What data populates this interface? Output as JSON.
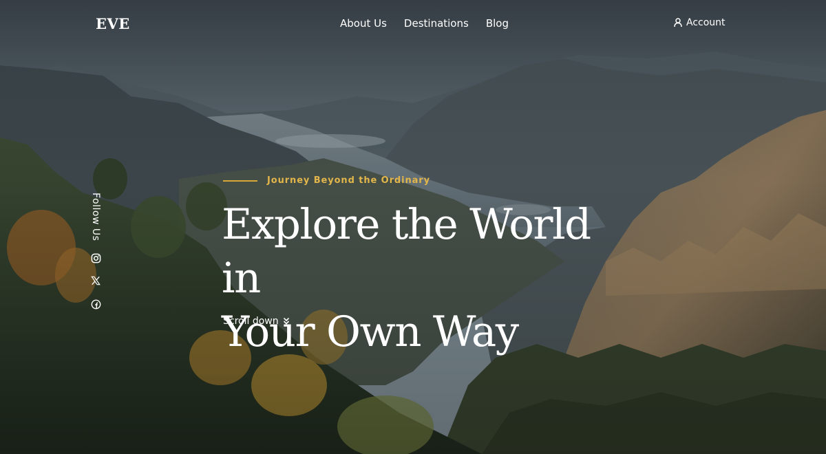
{
  "header": {
    "logo": "EVE",
    "nav": [
      "About Us",
      "Destinations",
      "Blog"
    ],
    "account_label": "Account",
    "account_icon": "user-icon"
  },
  "social": {
    "label": "Follow Us",
    "icons": [
      "instagram-icon",
      "x-icon",
      "facebook-icon"
    ]
  },
  "hero": {
    "tagline": "Journey Beyond the Ordinary",
    "headline_line1": "Explore the World in",
    "headline_line2": "Your Own Way",
    "scroll_label": "Scroll down",
    "scroll_icon": "chevrons-down-icon"
  },
  "colors": {
    "accent": "#e2b64a",
    "text": "#ffffff"
  }
}
